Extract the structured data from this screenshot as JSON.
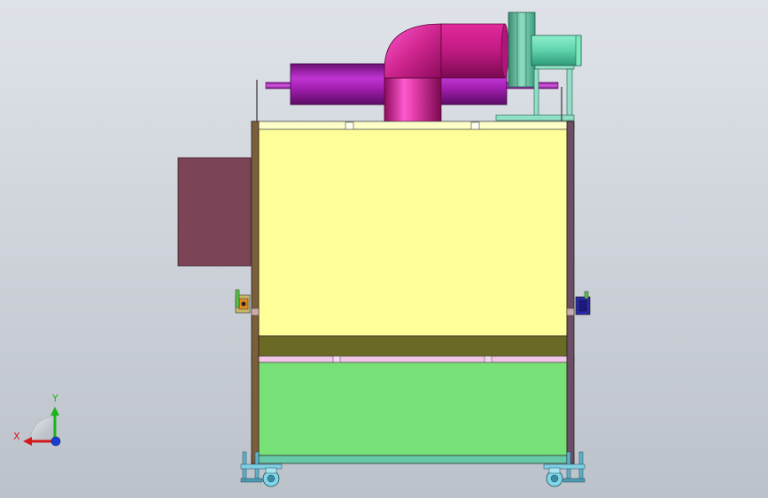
{
  "viewport": {
    "background_top": "#dfe3e9",
    "background_bottom": "#bcc2ca"
  },
  "model": {
    "cabinet_upper_color": "#ffff99",
    "cabinet_lower_color": "#77e077",
    "frame_color": "#7b5e3c",
    "side_box_color": "#7c4557",
    "duct_color": "#c71a8a",
    "horizontal_pipe_color": "#9c1aa8",
    "fan_color": "#66d9b3"
  },
  "triad": {
    "x_label": "X",
    "y_label": "Y",
    "x_color": "#d21a1a",
    "y_color": "#1ab31a",
    "z_color": "#1a3dd2"
  }
}
